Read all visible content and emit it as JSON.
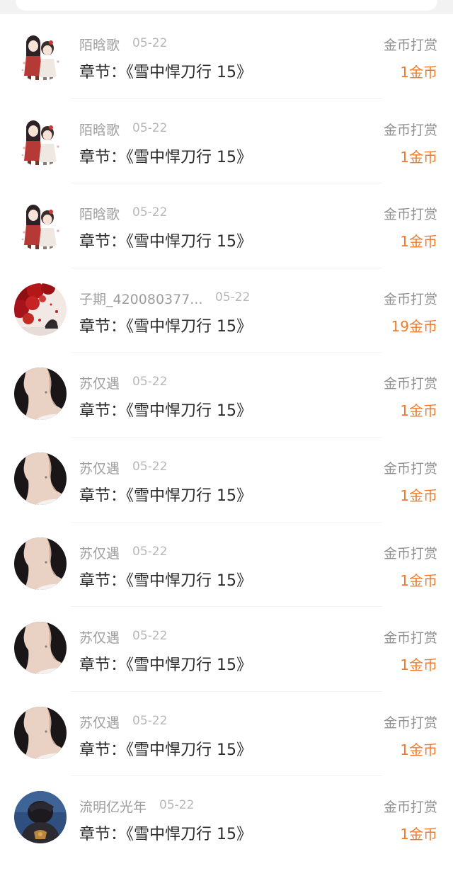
{
  "rewards": [
    {
      "name": "陌晗歌",
      "date": "05-22",
      "chapter": "章节：《雪中悍刀行 15》",
      "type": "金币打赏",
      "amount": "1金币",
      "avatar": "anime-couple-avatar"
    },
    {
      "name": "陌晗歌",
      "date": "05-22",
      "chapter": "章节：《雪中悍刀行 15》",
      "type": "金币打赏",
      "amount": "1金币",
      "avatar": "anime-couple-avatar"
    },
    {
      "name": "陌晗歌",
      "date": "05-22",
      "chapter": "章节：《雪中悍刀行 15》",
      "type": "金币打赏",
      "amount": "1金币",
      "avatar": "anime-couple-avatar"
    },
    {
      "name": "子期_420080377...",
      "date": "05-22",
      "chapter": "章节：《雪中悍刀行 15》",
      "type": "金币打赏",
      "amount": "19金币",
      "avatar": "red-blossom-avatar"
    },
    {
      "name": "苏仅遇",
      "date": "05-22",
      "chapter": "章节：《雪中悍刀行 15》",
      "type": "金币打赏",
      "amount": "1金币",
      "avatar": "neck-portrait-avatar"
    },
    {
      "name": "苏仅遇",
      "date": "05-22",
      "chapter": "章节：《雪中悍刀行 15》",
      "type": "金币打赏",
      "amount": "1金币",
      "avatar": "neck-portrait-avatar"
    },
    {
      "name": "苏仅遇",
      "date": "05-22",
      "chapter": "章节：《雪中悍刀行 15》",
      "type": "金币打赏",
      "amount": "1金币",
      "avatar": "neck-portrait-avatar"
    },
    {
      "name": "苏仅遇",
      "date": "05-22",
      "chapter": "章节：《雪中悍刀行 15》",
      "type": "金币打赏",
      "amount": "1金币",
      "avatar": "neck-portrait-avatar"
    },
    {
      "name": "苏仅遇",
      "date": "05-22",
      "chapter": "章节：《雪中悍刀行 15》",
      "type": "金币打赏",
      "amount": "1金币",
      "avatar": "neck-portrait-avatar"
    },
    {
      "name": "流明亿光年",
      "date": "05-22",
      "chapter": "章节：《雪中悍刀行 15》",
      "type": "金币打赏",
      "amount": "1金币",
      "avatar": "dark-blue-figure-avatar"
    }
  ],
  "colors": {
    "amount": "#f07b2a",
    "name": "#9e9e9e",
    "date": "#b8b8b8",
    "chapter": "#2b2b2b",
    "type": "#8f8f8f"
  }
}
